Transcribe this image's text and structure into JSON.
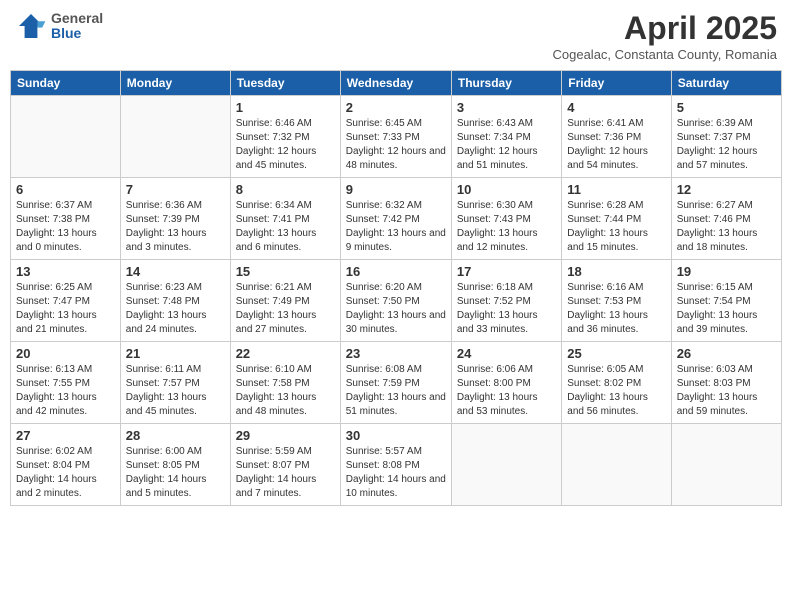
{
  "header": {
    "logo_general": "General",
    "logo_blue": "Blue",
    "month": "April 2025",
    "location": "Cogealac, Constanta County, Romania"
  },
  "days_of_week": [
    "Sunday",
    "Monday",
    "Tuesday",
    "Wednesday",
    "Thursday",
    "Friday",
    "Saturday"
  ],
  "weeks": [
    [
      {
        "day": "",
        "content": ""
      },
      {
        "day": "",
        "content": ""
      },
      {
        "day": "1",
        "content": "Sunrise: 6:46 AM\nSunset: 7:32 PM\nDaylight: 12 hours and 45 minutes."
      },
      {
        "day": "2",
        "content": "Sunrise: 6:45 AM\nSunset: 7:33 PM\nDaylight: 12 hours and 48 minutes."
      },
      {
        "day": "3",
        "content": "Sunrise: 6:43 AM\nSunset: 7:34 PM\nDaylight: 12 hours and 51 minutes."
      },
      {
        "day": "4",
        "content": "Sunrise: 6:41 AM\nSunset: 7:36 PM\nDaylight: 12 hours and 54 minutes."
      },
      {
        "day": "5",
        "content": "Sunrise: 6:39 AM\nSunset: 7:37 PM\nDaylight: 12 hours and 57 minutes."
      }
    ],
    [
      {
        "day": "6",
        "content": "Sunrise: 6:37 AM\nSunset: 7:38 PM\nDaylight: 13 hours and 0 minutes."
      },
      {
        "day": "7",
        "content": "Sunrise: 6:36 AM\nSunset: 7:39 PM\nDaylight: 13 hours and 3 minutes."
      },
      {
        "day": "8",
        "content": "Sunrise: 6:34 AM\nSunset: 7:41 PM\nDaylight: 13 hours and 6 minutes."
      },
      {
        "day": "9",
        "content": "Sunrise: 6:32 AM\nSunset: 7:42 PM\nDaylight: 13 hours and 9 minutes."
      },
      {
        "day": "10",
        "content": "Sunrise: 6:30 AM\nSunset: 7:43 PM\nDaylight: 13 hours and 12 minutes."
      },
      {
        "day": "11",
        "content": "Sunrise: 6:28 AM\nSunset: 7:44 PM\nDaylight: 13 hours and 15 minutes."
      },
      {
        "day": "12",
        "content": "Sunrise: 6:27 AM\nSunset: 7:46 PM\nDaylight: 13 hours and 18 minutes."
      }
    ],
    [
      {
        "day": "13",
        "content": "Sunrise: 6:25 AM\nSunset: 7:47 PM\nDaylight: 13 hours and 21 minutes."
      },
      {
        "day": "14",
        "content": "Sunrise: 6:23 AM\nSunset: 7:48 PM\nDaylight: 13 hours and 24 minutes."
      },
      {
        "day": "15",
        "content": "Sunrise: 6:21 AM\nSunset: 7:49 PM\nDaylight: 13 hours and 27 minutes."
      },
      {
        "day": "16",
        "content": "Sunrise: 6:20 AM\nSunset: 7:50 PM\nDaylight: 13 hours and 30 minutes."
      },
      {
        "day": "17",
        "content": "Sunrise: 6:18 AM\nSunset: 7:52 PM\nDaylight: 13 hours and 33 minutes."
      },
      {
        "day": "18",
        "content": "Sunrise: 6:16 AM\nSunset: 7:53 PM\nDaylight: 13 hours and 36 minutes."
      },
      {
        "day": "19",
        "content": "Sunrise: 6:15 AM\nSunset: 7:54 PM\nDaylight: 13 hours and 39 minutes."
      }
    ],
    [
      {
        "day": "20",
        "content": "Sunrise: 6:13 AM\nSunset: 7:55 PM\nDaylight: 13 hours and 42 minutes."
      },
      {
        "day": "21",
        "content": "Sunrise: 6:11 AM\nSunset: 7:57 PM\nDaylight: 13 hours and 45 minutes."
      },
      {
        "day": "22",
        "content": "Sunrise: 6:10 AM\nSunset: 7:58 PM\nDaylight: 13 hours and 48 minutes."
      },
      {
        "day": "23",
        "content": "Sunrise: 6:08 AM\nSunset: 7:59 PM\nDaylight: 13 hours and 51 minutes."
      },
      {
        "day": "24",
        "content": "Sunrise: 6:06 AM\nSunset: 8:00 PM\nDaylight: 13 hours and 53 minutes."
      },
      {
        "day": "25",
        "content": "Sunrise: 6:05 AM\nSunset: 8:02 PM\nDaylight: 13 hours and 56 minutes."
      },
      {
        "day": "26",
        "content": "Sunrise: 6:03 AM\nSunset: 8:03 PM\nDaylight: 13 hours and 59 minutes."
      }
    ],
    [
      {
        "day": "27",
        "content": "Sunrise: 6:02 AM\nSunset: 8:04 PM\nDaylight: 14 hours and 2 minutes."
      },
      {
        "day": "28",
        "content": "Sunrise: 6:00 AM\nSunset: 8:05 PM\nDaylight: 14 hours and 5 minutes."
      },
      {
        "day": "29",
        "content": "Sunrise: 5:59 AM\nSunset: 8:07 PM\nDaylight: 14 hours and 7 minutes."
      },
      {
        "day": "30",
        "content": "Sunrise: 5:57 AM\nSunset: 8:08 PM\nDaylight: 14 hours and 10 minutes."
      },
      {
        "day": "",
        "content": ""
      },
      {
        "day": "",
        "content": ""
      },
      {
        "day": "",
        "content": ""
      }
    ]
  ]
}
